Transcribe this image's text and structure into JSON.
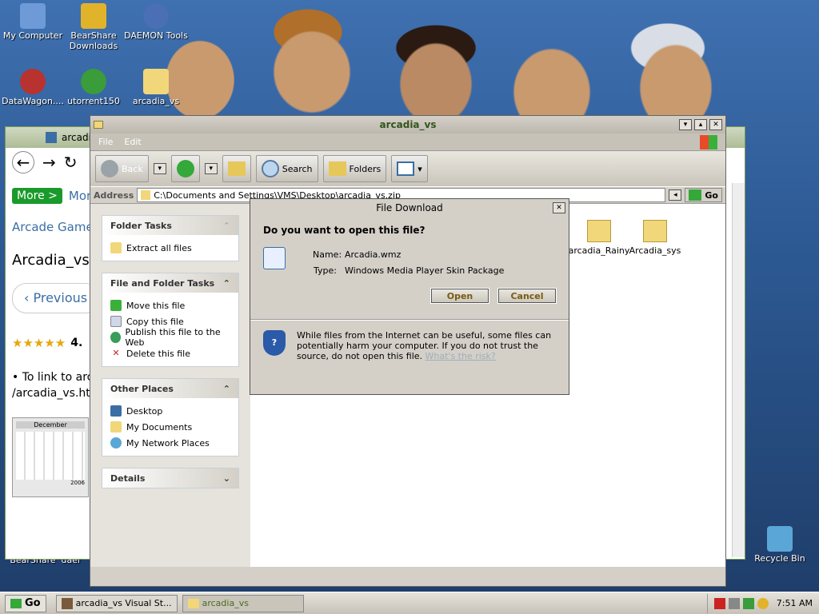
{
  "desktop_icons": [
    {
      "label": "My Computer",
      "icon": "my-computer-icon",
      "color": "#6e9ad8"
    },
    {
      "label": "BearShare Downloads",
      "icon": "bearshare-icon",
      "color": "#e1b32a"
    },
    {
      "label": "DAEMON Tools",
      "icon": "daemon-tools-icon",
      "color": "#4a6fb5"
    },
    {
      "label": "DataWagon....",
      "icon": "datawagon-icon",
      "color": "#b8322f"
    },
    {
      "label": "utorrent150",
      "icon": "utorrent-icon",
      "color": "#3a9c3a"
    },
    {
      "label": "arcadia_vs",
      "icon": "zip-folder-icon",
      "color": "#f1d77a"
    },
    {
      "label": "Recycle Bin",
      "icon": "recycle-bin-icon",
      "color": "#5aa6d6"
    },
    {
      "label": "BearShare",
      "icon": "bearshare-icon",
      "color": "#e1b32a"
    },
    {
      "label": "daer",
      "icon": "daemon-tools-icon",
      "color": "#4a6fb5"
    }
  ],
  "browser": {
    "tab_title": "arcadi",
    "more_label": "More >",
    "more_text": "Mor",
    "breadcrumb": "Arcade Game",
    "heading": "Arcadia_vs",
    "previous": "‹ Previous I",
    "stars": "★★★★★",
    "rating": "4.",
    "link_line1": "• To link to arc",
    "link_line2": "/arcadia_vs.ht",
    "calendar_month": "December",
    "calendar_year": "2006"
  },
  "explorer": {
    "title": "arcadia_vs",
    "menu": [
      "File",
      "Edit"
    ],
    "toolbar": {
      "back": "Back",
      "search": "Search",
      "folders": "Folders"
    },
    "address_label": "Address",
    "address_value": "C:\\Documents and Settings\\VMS\\Desktop\\arcadia_vs.zip",
    "go_label": "Go",
    "folder_tasks": {
      "title": "Folder Tasks",
      "items": [
        "Extract all files"
      ]
    },
    "file_folder_tasks": {
      "title": "File and Folder Tasks",
      "items": [
        "Move this file",
        "Copy this file",
        "Publish this file to the Web",
        "Delete this file"
      ]
    },
    "other_places": {
      "title": "Other Places",
      "items": [
        "Desktop",
        "My Documents",
        "My Network Places"
      ]
    },
    "details": {
      "title": "Details"
    },
    "files": [
      "arcadia_Rainy",
      "Arcadia_sys"
    ]
  },
  "dialog": {
    "title": "File Download",
    "question": "Do you want to open this file?",
    "name_label": "Name:",
    "name_value": "Arcadia.wmz",
    "type_label": "Type:",
    "type_value": "Windows Media Player Skin Package",
    "open": "Open",
    "cancel": "Cancel",
    "warning": "While files from the Internet can be useful, some files can potentially harm your computer. If you do not trust the source, do not open this file.",
    "risk_link": "What's the risk?"
  },
  "taskbar": {
    "start": "Go",
    "items": [
      "arcadia_vs Visual St...",
      "arcadia_vs"
    ],
    "clock": "7:51 AM"
  },
  "colors": {
    "accent_green": "#33551a",
    "link_blue": "#3a6ea5",
    "more_green": "#1a9a2a"
  }
}
